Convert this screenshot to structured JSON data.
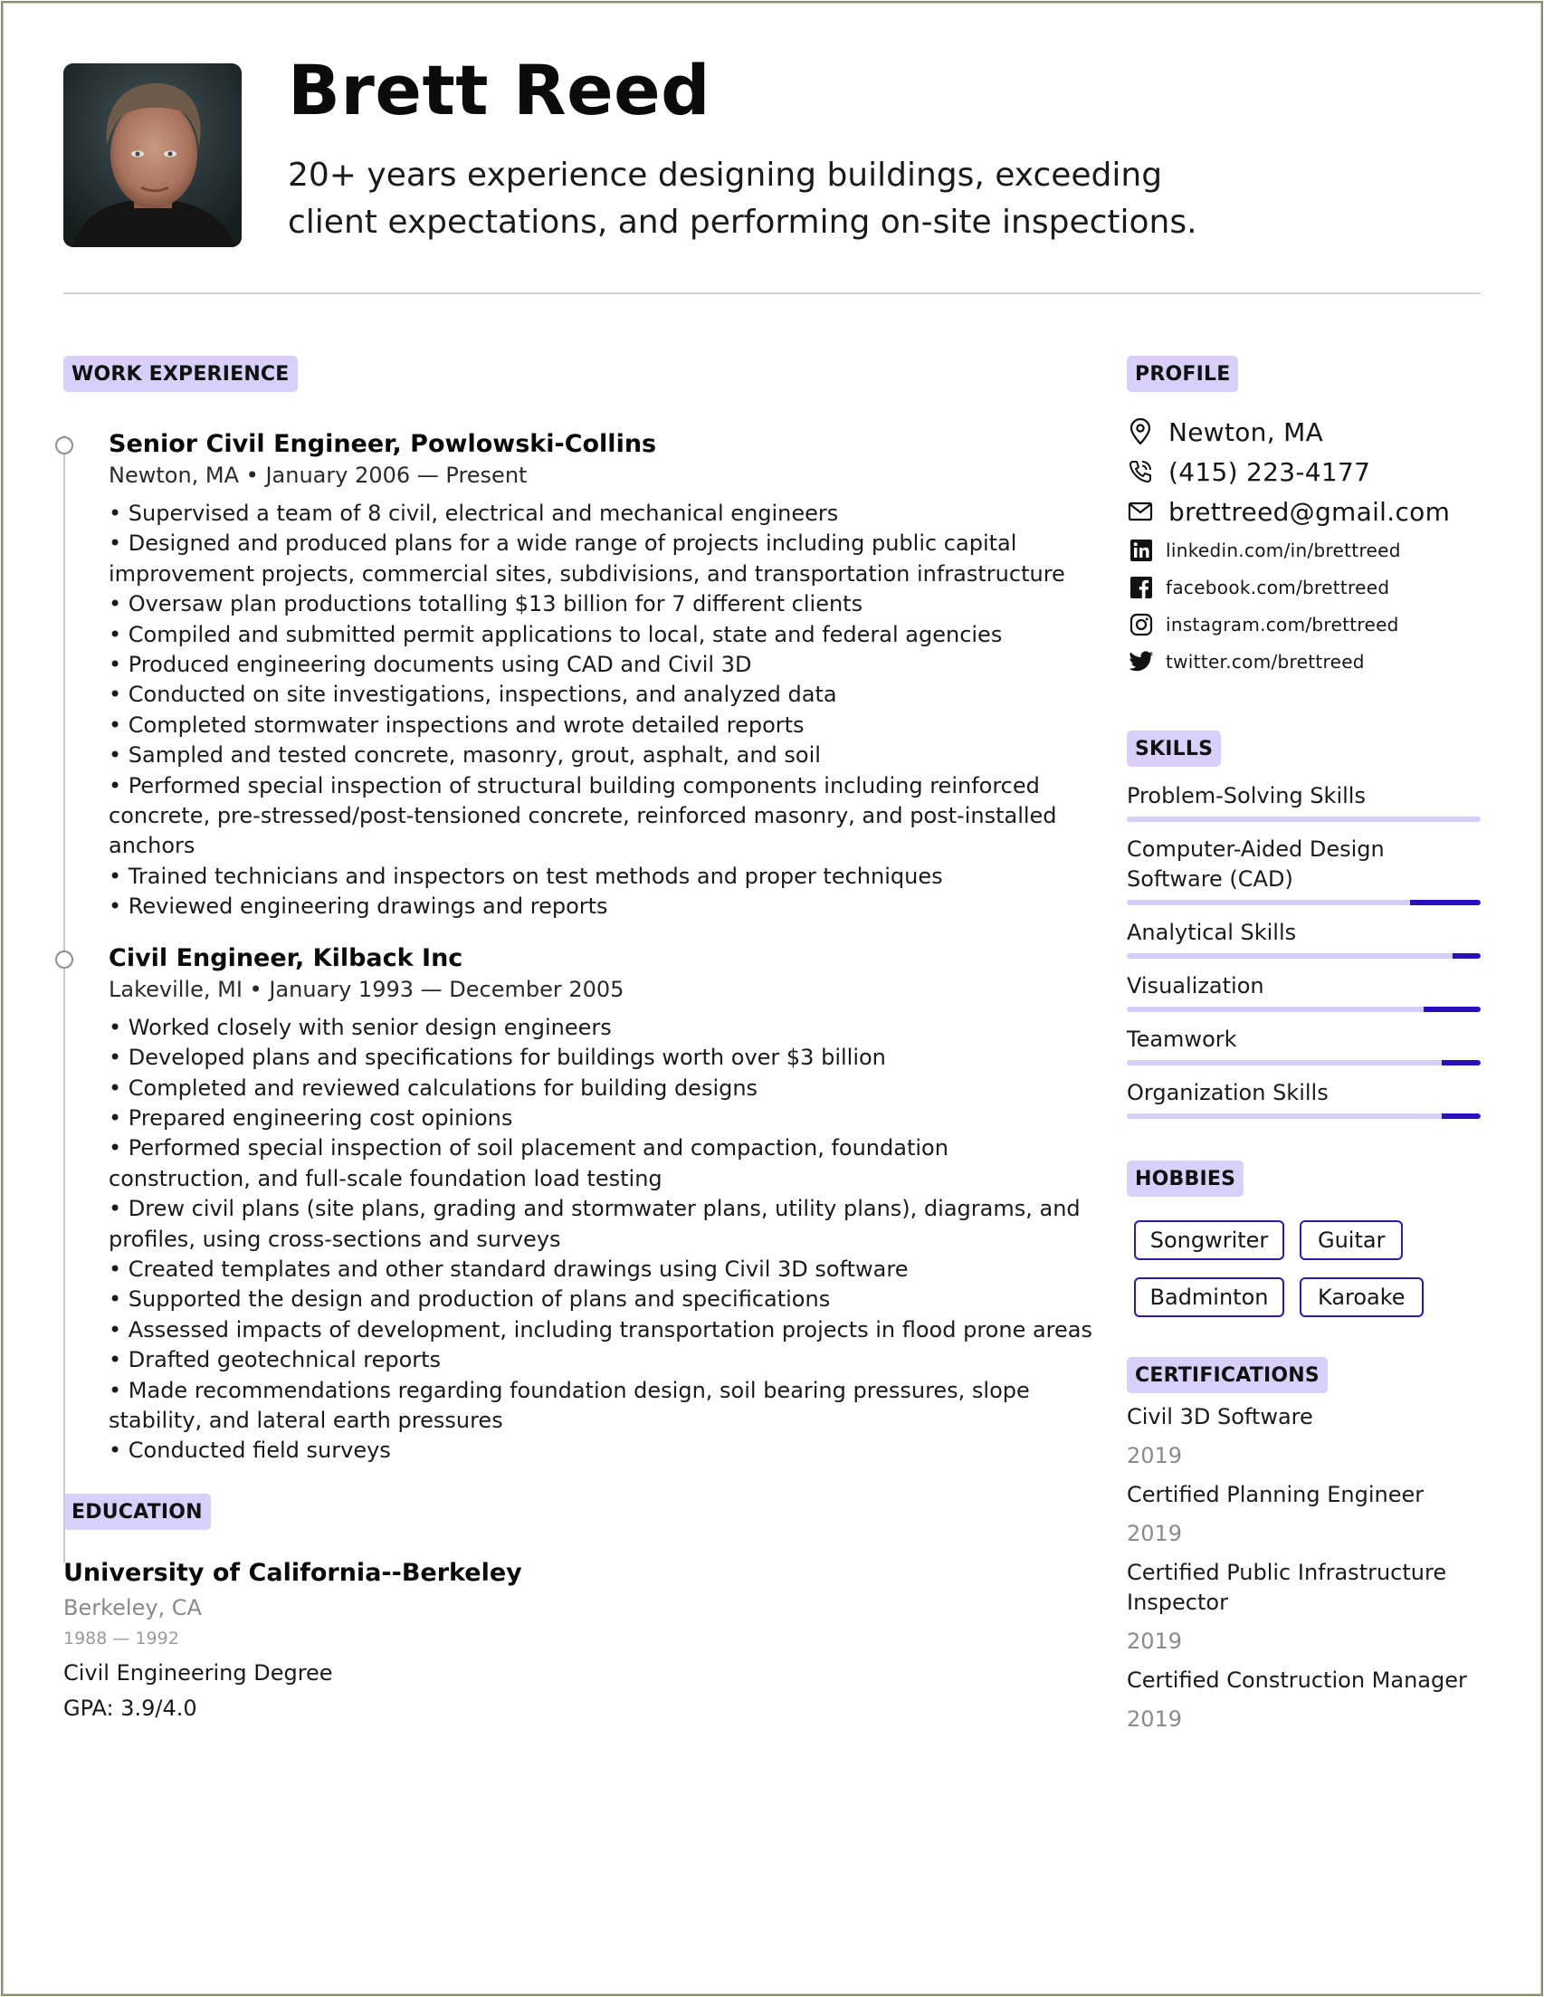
{
  "header": {
    "name": "Brett Reed",
    "summary": "20+ years experience designing buildings, exceeding client expectations, and performing on-site inspections."
  },
  "sections": {
    "work_experience": "WORK EXPERIENCE",
    "education": "EDUCATION",
    "profile": "PROFILE",
    "skills": "SKILLS",
    "hobbies": "HOBBIES",
    "certifications": "CERTIFICATIONS"
  },
  "jobs": [
    {
      "title": "Senior Civil Engineer, Powlowski-Collins",
      "meta": "Newton, MA • January 2006 — Present",
      "bullets": [
        "• Supervised a team of 8 civil, electrical and mechanical engineers",
        "• Designed and produced plans for a wide range of projects including public capital improvement projects, commercial sites, subdivisions, and transportation infrastructure",
        "• Oversaw plan productions totalling $13 billion for 7 different clients",
        "• Compiled and submitted permit applications to local, state and federal agencies",
        "• Produced engineering documents using CAD and Civil 3D",
        "• Conducted on site investigations, inspections, and analyzed data",
        "• Completed stormwater inspections and wrote detailed reports",
        "• Sampled and tested concrete, masonry, grout, asphalt, and soil",
        "• Performed special inspection of structural building components including reinforced concrete, pre-stressed/post-tensioned concrete, reinforced masonry, and post-installed anchors",
        "• Trained technicians and inspectors on test methods and proper techniques",
        "• Reviewed engineering drawings and reports"
      ]
    },
    {
      "title": "Civil Engineer, Kilback Inc",
      "meta": "Lakeville, MI • January 1993 — December 2005",
      "bullets": [
        "• Worked closely with senior design engineers",
        "• Developed plans and specifications for buildings worth over $3 billion",
        "• Completed and reviewed calculations for building designs",
        "• Prepared engineering cost opinions",
        "• Performed special inspection of soil placement and compaction, foundation construction, and full-scale foundation load testing",
        "• Drew civil plans (site plans, grading and stormwater plans, utility plans), diagrams, and profiles, using cross-sections and surveys",
        "• Created templates and other standard drawings using Civil 3D software",
        "• Supported the design and production of plans and specifications",
        "• Assessed impacts of development, including transportation projects in flood prone areas",
        "• Drafted geotechnical reports",
        "• Made recommendations regarding foundation design, soil bearing pressures, slope stability, and lateral earth pressures",
        "• Conducted field surveys"
      ]
    }
  ],
  "education": {
    "school": "University of California--Berkeley",
    "location": "Berkeley, CA",
    "years": "1988 — 1992",
    "degree": "Civil Engineering Degree",
    "gpa": "GPA: 3.9/4.0"
  },
  "profile": {
    "location": {
      "icon": "map-pin-icon",
      "text": "Newton, MA"
    },
    "phone": {
      "icon": "phone-icon",
      "text": "(415) 223-4177"
    },
    "email": {
      "icon": "mail-icon",
      "text": "brettreed@gmail.com"
    },
    "linkedin": {
      "icon": "linkedin-icon",
      "text": "linkedin.com/in/brettreed"
    },
    "facebook": {
      "icon": "facebook-icon",
      "text": "facebook.com/brettreed"
    },
    "instagram": {
      "icon": "instagram-icon",
      "text": "instagram.com/brettreed"
    },
    "twitter": {
      "icon": "twitter-icon",
      "text": "twitter.com/brettreed"
    }
  },
  "skills": [
    {
      "name": "Problem-Solving Skills",
      "dark_fraction": 0.0
    },
    {
      "name": "Computer-Aided Design Software (CAD)",
      "dark_fraction": 0.2
    },
    {
      "name": "Analytical Skills",
      "dark_fraction": 0.08
    },
    {
      "name": "Visualization",
      "dark_fraction": 0.16
    },
    {
      "name": "Teamwork",
      "dark_fraction": 0.11
    },
    {
      "name": "Organization Skills",
      "dark_fraction": 0.11
    }
  ],
  "hobbies": [
    "Songwriter",
    "Guitar",
    "Badminton",
    "Karoake"
  ],
  "certifications": [
    {
      "name": "Civil 3D Software",
      "year": "2019"
    },
    {
      "name": "Certified Planning Engineer",
      "year": "2019"
    },
    {
      "name": "Certified Public Infrastructure Inspector",
      "year": "2019"
    },
    {
      "name": "Certified Construction Manager",
      "year": "2019"
    }
  ],
  "colors": {
    "badge_bg": "#d8d0fb",
    "skill_track": "#d5cdfa",
    "skill_fill": "#2a10b8",
    "hobby_border": "#3217a8",
    "muted_text": "#8a8a8a"
  }
}
